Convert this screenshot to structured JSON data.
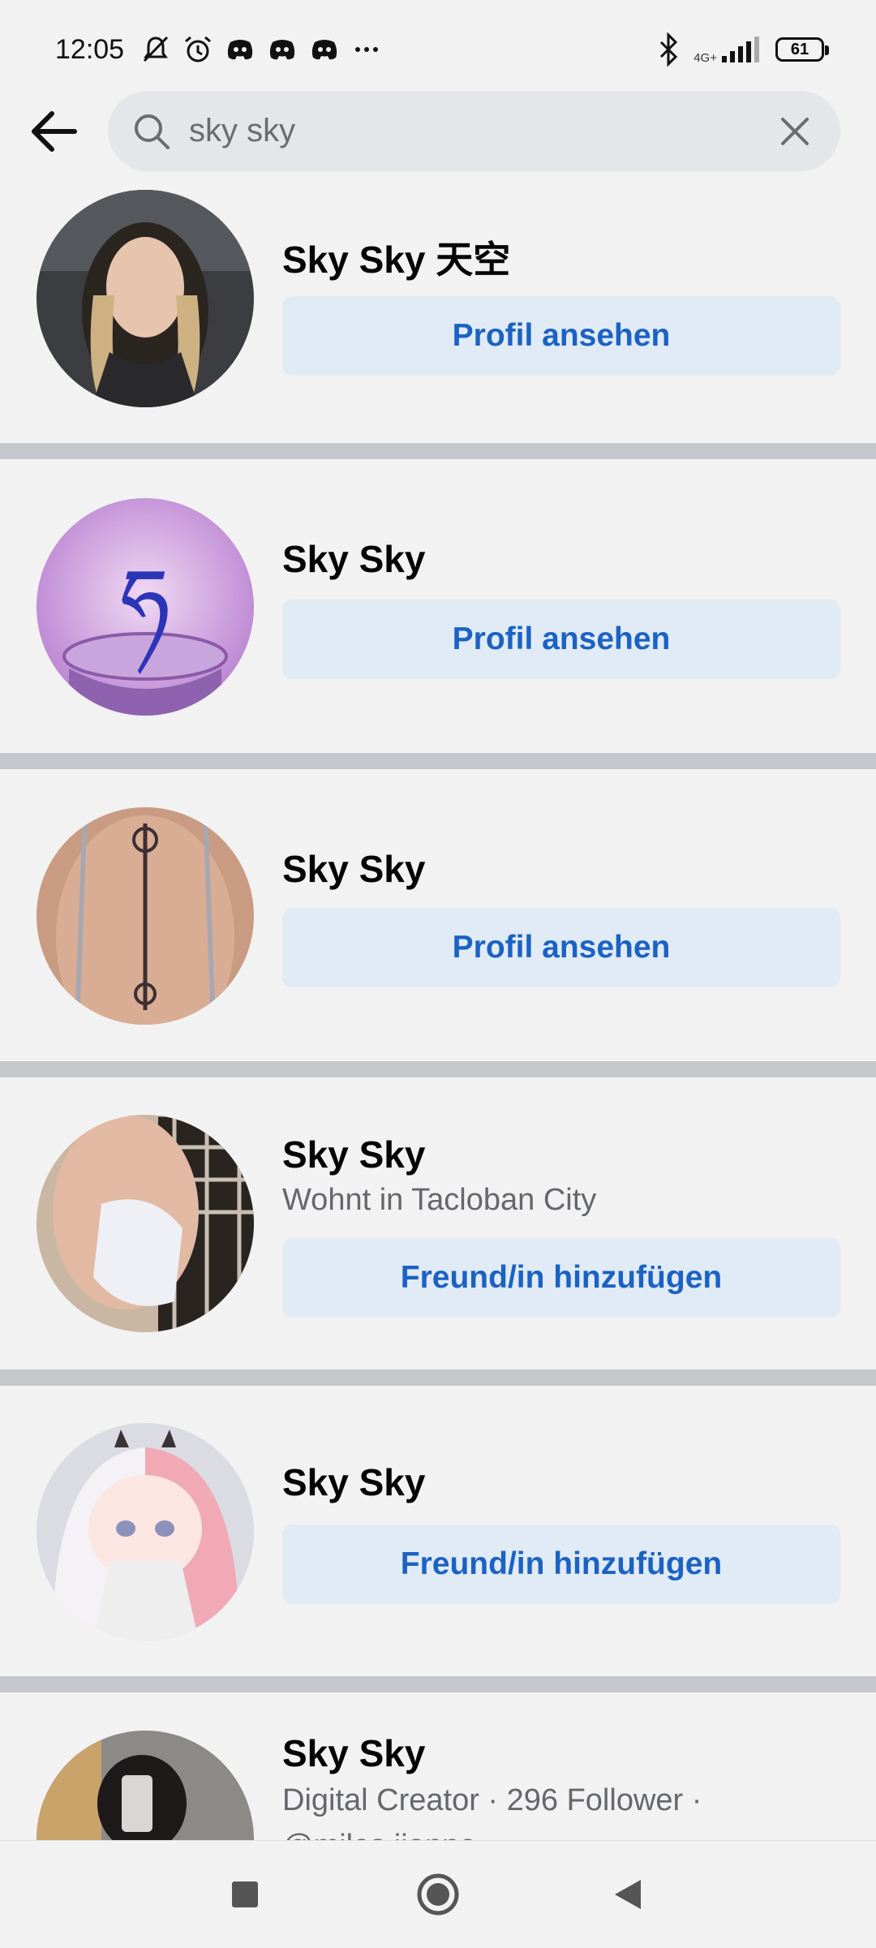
{
  "status_bar": {
    "time": "12:05",
    "network": "4G+",
    "battery": "61",
    "icons": [
      "mute-bell-icon",
      "alarm-icon",
      "discord-icon",
      "discord-icon",
      "discord-icon",
      "more-icon",
      "bluetooth-icon",
      "signal-icon",
      "battery-icon"
    ]
  },
  "search": {
    "query": "sky sky",
    "icons": {
      "back": "arrow-left-icon",
      "search": "search-icon",
      "clear": "close-icon"
    }
  },
  "results": [
    {
      "name": "Sky Sky 天空",
      "action": "Profil ansehen"
    },
    {
      "name": "Sky Sky",
      "action": "Profil ansehen"
    },
    {
      "name": "Sky Sky",
      "action": "Profil ansehen"
    },
    {
      "name": "Sky Sky",
      "subtitle": "Wohnt in Tacloban City",
      "action": "Freund/in hinzufügen"
    },
    {
      "name": "Sky Sky",
      "action": "Freund/in hinzufügen"
    },
    {
      "name": "Sky Sky",
      "subtitle": "Digital Creator · 296 Follower ·",
      "subtitle2": "@miles.jianne"
    }
  ],
  "nav_bar": {
    "icons": [
      "recents-square-icon",
      "home-circle-icon",
      "back-triangle-icon"
    ]
  },
  "colors": {
    "button_bg": "#e1ebf6",
    "button_text": "#1b62c3",
    "separator": "#c4c7cc",
    "background": "#f2f2f2"
  }
}
